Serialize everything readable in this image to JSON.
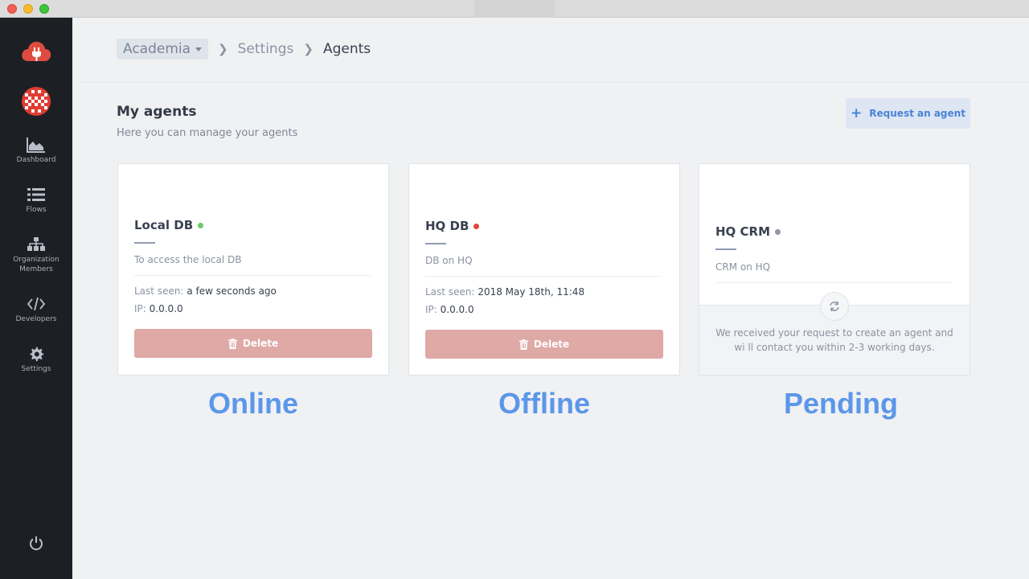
{
  "sidebar": {
    "nav": [
      {
        "label": "Dashboard",
        "icon": "area-chart-icon"
      },
      {
        "label": "Flows",
        "icon": "list-icon"
      },
      {
        "label": "Organization Members",
        "icon": "sitemap-icon"
      },
      {
        "label": "Developers",
        "icon": "code-icon"
      },
      {
        "label": "Settings",
        "icon": "gear-icon"
      }
    ]
  },
  "breadcrumb": {
    "organization": "Academia",
    "settings": "Settings",
    "current": "Agents"
  },
  "page": {
    "title": "My agents",
    "subtitle": "Here you can manage your agents",
    "request_button": "Request an agent"
  },
  "agents": [
    {
      "name": "Local DB",
      "status": "online",
      "status_color": "#6cc96c",
      "description": "To access the local DB",
      "last_seen_label": "Last seen:",
      "last_seen": "a few seconds ago",
      "ip_label": "IP:",
      "ip": "0.0.0.0",
      "delete_label": "Delete",
      "caption": "Online"
    },
    {
      "name": "HQ DB",
      "status": "offline",
      "status_color": "#e0473f",
      "description": "DB on HQ",
      "last_seen_label": "Last seen:",
      "last_seen": "2018 May 18th, 11:48",
      "ip_label": "IP:",
      "ip": "0.0.0.0",
      "delete_label": "Delete",
      "caption": "Offline"
    },
    {
      "name": "HQ CRM",
      "status": "pending",
      "status_color": "#8e97a8",
      "description": "CRM on HQ",
      "pending_message": "We received your request to create an agent and wi ll contact you within 2-3 working days.",
      "caption": "Pending"
    }
  ],
  "colors": {
    "sidebar_bg": "#1c1f24",
    "accent_blue": "#4a83d6",
    "delete_red": "#dfa9a6",
    "caption_blue": "#5b97e9",
    "logo_red": "#e04b3f"
  }
}
